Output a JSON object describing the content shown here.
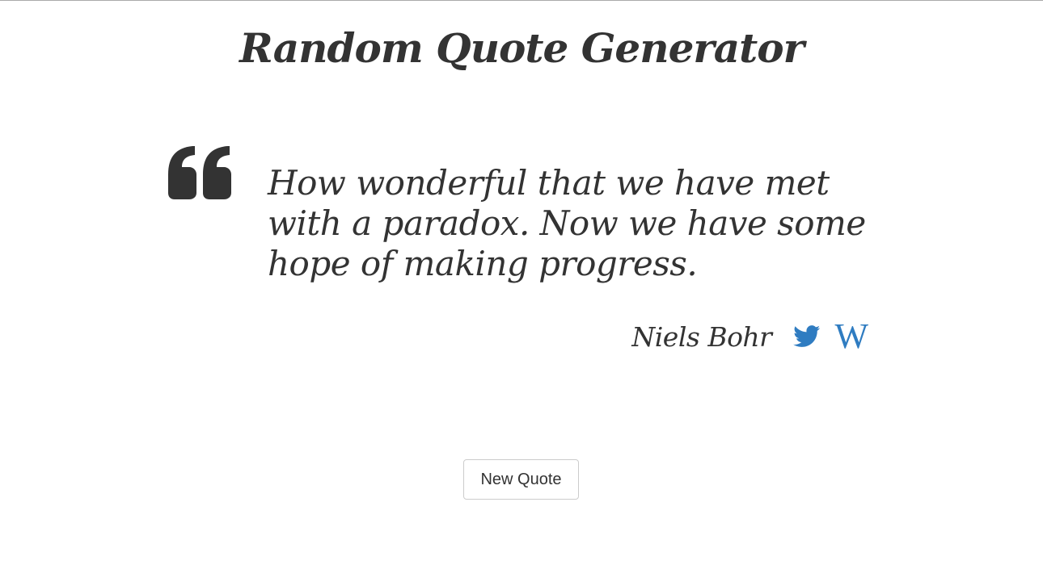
{
  "page": {
    "title": "Random Quote Generator"
  },
  "quote": {
    "text": "How wonderful that we have met with a paradox. Now we have some hope of making progress.",
    "author": "Niels Bohr",
    "quote_icon": "quote-left-icon"
  },
  "share": {
    "twitter_icon": "twitter-icon",
    "wikipedia_icon": "wikipedia-icon",
    "wikipedia_label": "W"
  },
  "actions": {
    "new_quote_label": "New Quote"
  },
  "colors": {
    "text": "#333333",
    "accent": "#2f7cc1",
    "button_border": "#cccccc"
  }
}
